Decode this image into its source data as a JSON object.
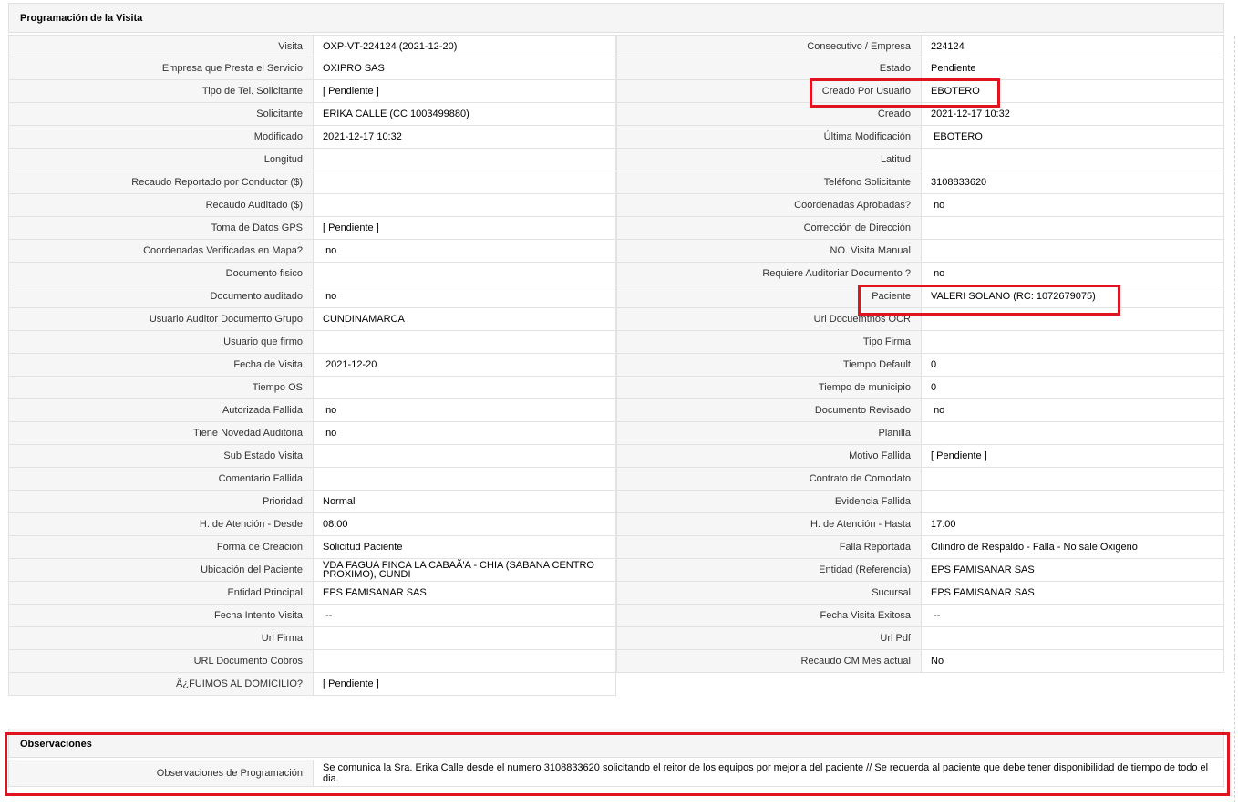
{
  "section_title": "Programación de la Visita",
  "rows": [
    [
      {
        "label": "Visita",
        "value": "OXP-VT-224124 (2021-12-20)"
      },
      {
        "label": "Consecutivo / Empresa",
        "value": "224124"
      }
    ],
    [
      {
        "label": "Empresa que Presta el Servicio",
        "value": "OXIPRO SAS"
      },
      {
        "label": "Estado",
        "value": "Pendiente"
      }
    ],
    [
      {
        "label": "Tipo de Tel. Solicitante",
        "value": "[ Pendiente ]"
      },
      {
        "label": "Creado Por Usuario",
        "value": "EBOTERO"
      }
    ],
    [
      {
        "label": "Solicitante",
        "value": "ERIKA CALLE (CC 1003499880)"
      },
      {
        "label": "Creado",
        "value": "2021-12-17 10:32"
      }
    ],
    [
      {
        "label": "Modificado",
        "value": "2021-12-17 10:32"
      },
      {
        "label": "Última Modificación",
        "value": " EBOTERO"
      }
    ],
    [
      {
        "label": "Longitud",
        "value": ""
      },
      {
        "label": "Latitud",
        "value": ""
      }
    ],
    [
      {
        "label": "Recaudo Reportado por Conductor ($)",
        "value": ""
      },
      {
        "label": "Teléfono Solicitante",
        "value": "3108833620"
      }
    ],
    [
      {
        "label": "Recaudo Auditado ($)",
        "value": ""
      },
      {
        "label": "Coordenadas Aprobadas?",
        "value": " no"
      }
    ],
    [
      {
        "label": "Toma de Datos GPS",
        "value": "[ Pendiente ]"
      },
      {
        "label": "Corrección de Dirección",
        "value": ""
      }
    ],
    [
      {
        "label": "Coordenadas Verificadas en Mapa?",
        "value": " no"
      },
      {
        "label": "NO. Visita Manual",
        "value": ""
      }
    ],
    [
      {
        "label": "Documento fisico",
        "value": ""
      },
      {
        "label": "Requiere Auditoriar Documento ?",
        "value": " no"
      }
    ],
    [
      {
        "label": "Documento auditado",
        "value": " no"
      },
      {
        "label": "Paciente",
        "value": "VALERI SOLANO (RC: 1072679075)"
      }
    ],
    [
      {
        "label": "Usuario Auditor Documento Grupo",
        "value": "CUNDINAMARCA"
      },
      {
        "label": "Url Docuemtnos OCR",
        "value": ""
      }
    ],
    [
      {
        "label": "Usuario que firmo",
        "value": ""
      },
      {
        "label": "Tipo Firma",
        "value": ""
      }
    ],
    [
      {
        "label": "Fecha de Visita",
        "value": " 2021-12-20"
      },
      {
        "label": "Tiempo Default",
        "value": "0"
      }
    ],
    [
      {
        "label": "Tiempo OS",
        "value": ""
      },
      {
        "label": "Tiempo de municipio",
        "value": "0"
      }
    ],
    [
      {
        "label": "Autorizada Fallida",
        "value": " no"
      },
      {
        "label": "Documento Revisado",
        "value": " no"
      }
    ],
    [
      {
        "label": "Tiene Novedad Auditoria",
        "value": " no"
      },
      {
        "label": "Planilla",
        "value": ""
      }
    ],
    [
      {
        "label": "Sub Estado Visita",
        "value": ""
      },
      {
        "label": "Motivo Fallida",
        "value": "[ Pendiente ]"
      }
    ],
    [
      {
        "label": "Comentario Fallida",
        "value": ""
      },
      {
        "label": "Contrato de Comodato",
        "value": ""
      }
    ],
    [
      {
        "label": "Prioridad",
        "value": "Normal"
      },
      {
        "label": "Evidencia Fallida",
        "value": ""
      }
    ],
    [
      {
        "label": "H. de Atención - Desde",
        "value": "08:00"
      },
      {
        "label": "H. de Atención - Hasta",
        "value": "17:00"
      }
    ],
    [
      {
        "label": "Forma de Creación",
        "value": "Solicitud Paciente"
      },
      {
        "label": "Falla Reportada",
        "value": "Cilindro de Respaldo - Falla - No sale Oxigeno"
      }
    ],
    [
      {
        "label": "Ubicación del Paciente",
        "value": "VDA FAGUA FINCA LA CABAÃ'A - CHIA (SABANA CENTRO PROXIMO), CUNDI"
      },
      {
        "label": "Entidad (Referencia)",
        "value": "EPS FAMISANAR SAS"
      }
    ],
    [
      {
        "label": "Entidad Principal",
        "value": "EPS FAMISANAR SAS"
      },
      {
        "label": "Sucursal",
        "value": "EPS FAMISANAR SAS"
      }
    ],
    [
      {
        "label": "Fecha Intento Visita",
        "value": " --"
      },
      {
        "label": "Fecha Visita Exitosa",
        "value": " --"
      }
    ],
    [
      {
        "label": "Url Firma",
        "value": ""
      },
      {
        "label": "Url Pdf",
        "value": ""
      }
    ],
    [
      {
        "label": "URL Documento Cobros",
        "value": ""
      },
      {
        "label": "Recaudo CM Mes actual",
        "value": "No"
      }
    ],
    [
      {
        "label": "Â¿FUIMOS AL DOMICILIO?",
        "value": "[ Pendiente ]"
      },
      null
    ]
  ],
  "observaciones": {
    "title": "Observaciones",
    "label": "Observaciones de Programación",
    "value": "  Se comunica la Sra. Erika Calle desde el numero 3108833620 solicitando el reitor de los equipos por mejoria del paciente // Se recuerda al paciente que debe tener disponibilidad de tiempo de todo el dia."
  },
  "highlight_color": "#e0141e"
}
